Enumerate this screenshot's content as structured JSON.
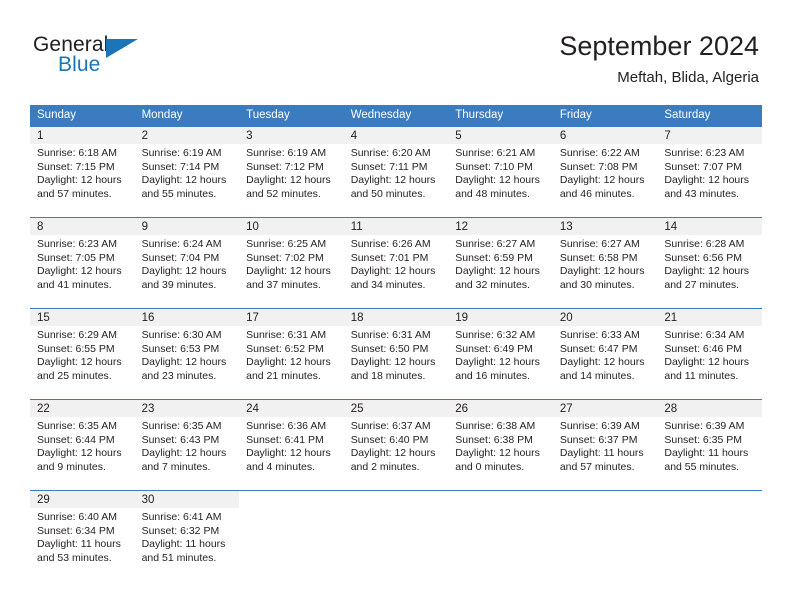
{
  "brand": {
    "name_part1": "General",
    "name_part2": "Blue",
    "accent_color": "#1b75bb",
    "flag_icon": "brand-flag-icon"
  },
  "header": {
    "title": "September 2024",
    "location": "Meftah, Blida, Algeria"
  },
  "calendar": {
    "header_bg": "#3b7cc0",
    "daynum_bg": "#f1f1f1",
    "weekdays": [
      "Sunday",
      "Monday",
      "Tuesday",
      "Wednesday",
      "Thursday",
      "Friday",
      "Saturday"
    ],
    "weeks": [
      [
        {
          "day": "1",
          "sunrise": "Sunrise: 6:18 AM",
          "sunset": "Sunset: 7:15 PM",
          "daylight": "Daylight: 12 hours and 57 minutes."
        },
        {
          "day": "2",
          "sunrise": "Sunrise: 6:19 AM",
          "sunset": "Sunset: 7:14 PM",
          "daylight": "Daylight: 12 hours and 55 minutes."
        },
        {
          "day": "3",
          "sunrise": "Sunrise: 6:19 AM",
          "sunset": "Sunset: 7:12 PM",
          "daylight": "Daylight: 12 hours and 52 minutes."
        },
        {
          "day": "4",
          "sunrise": "Sunrise: 6:20 AM",
          "sunset": "Sunset: 7:11 PM",
          "daylight": "Daylight: 12 hours and 50 minutes."
        },
        {
          "day": "5",
          "sunrise": "Sunrise: 6:21 AM",
          "sunset": "Sunset: 7:10 PM",
          "daylight": "Daylight: 12 hours and 48 minutes."
        },
        {
          "day": "6",
          "sunrise": "Sunrise: 6:22 AM",
          "sunset": "Sunset: 7:08 PM",
          "daylight": "Daylight: 12 hours and 46 minutes."
        },
        {
          "day": "7",
          "sunrise": "Sunrise: 6:23 AM",
          "sunset": "Sunset: 7:07 PM",
          "daylight": "Daylight: 12 hours and 43 minutes."
        }
      ],
      [
        {
          "day": "8",
          "sunrise": "Sunrise: 6:23 AM",
          "sunset": "Sunset: 7:05 PM",
          "daylight": "Daylight: 12 hours and 41 minutes."
        },
        {
          "day": "9",
          "sunrise": "Sunrise: 6:24 AM",
          "sunset": "Sunset: 7:04 PM",
          "daylight": "Daylight: 12 hours and 39 minutes."
        },
        {
          "day": "10",
          "sunrise": "Sunrise: 6:25 AM",
          "sunset": "Sunset: 7:02 PM",
          "daylight": "Daylight: 12 hours and 37 minutes."
        },
        {
          "day": "11",
          "sunrise": "Sunrise: 6:26 AM",
          "sunset": "Sunset: 7:01 PM",
          "daylight": "Daylight: 12 hours and 34 minutes."
        },
        {
          "day": "12",
          "sunrise": "Sunrise: 6:27 AM",
          "sunset": "Sunset: 6:59 PM",
          "daylight": "Daylight: 12 hours and 32 minutes."
        },
        {
          "day": "13",
          "sunrise": "Sunrise: 6:27 AM",
          "sunset": "Sunset: 6:58 PM",
          "daylight": "Daylight: 12 hours and 30 minutes."
        },
        {
          "day": "14",
          "sunrise": "Sunrise: 6:28 AM",
          "sunset": "Sunset: 6:56 PM",
          "daylight": "Daylight: 12 hours and 27 minutes."
        }
      ],
      [
        {
          "day": "15",
          "sunrise": "Sunrise: 6:29 AM",
          "sunset": "Sunset: 6:55 PM",
          "daylight": "Daylight: 12 hours and 25 minutes."
        },
        {
          "day": "16",
          "sunrise": "Sunrise: 6:30 AM",
          "sunset": "Sunset: 6:53 PM",
          "daylight": "Daylight: 12 hours and 23 minutes."
        },
        {
          "day": "17",
          "sunrise": "Sunrise: 6:31 AM",
          "sunset": "Sunset: 6:52 PM",
          "daylight": "Daylight: 12 hours and 21 minutes."
        },
        {
          "day": "18",
          "sunrise": "Sunrise: 6:31 AM",
          "sunset": "Sunset: 6:50 PM",
          "daylight": "Daylight: 12 hours and 18 minutes."
        },
        {
          "day": "19",
          "sunrise": "Sunrise: 6:32 AM",
          "sunset": "Sunset: 6:49 PM",
          "daylight": "Daylight: 12 hours and 16 minutes."
        },
        {
          "day": "20",
          "sunrise": "Sunrise: 6:33 AM",
          "sunset": "Sunset: 6:47 PM",
          "daylight": "Daylight: 12 hours and 14 minutes."
        },
        {
          "day": "21",
          "sunrise": "Sunrise: 6:34 AM",
          "sunset": "Sunset: 6:46 PM",
          "daylight": "Daylight: 12 hours and 11 minutes."
        }
      ],
      [
        {
          "day": "22",
          "sunrise": "Sunrise: 6:35 AM",
          "sunset": "Sunset: 6:44 PM",
          "daylight": "Daylight: 12 hours and 9 minutes."
        },
        {
          "day": "23",
          "sunrise": "Sunrise: 6:35 AM",
          "sunset": "Sunset: 6:43 PM",
          "daylight": "Daylight: 12 hours and 7 minutes."
        },
        {
          "day": "24",
          "sunrise": "Sunrise: 6:36 AM",
          "sunset": "Sunset: 6:41 PM",
          "daylight": "Daylight: 12 hours and 4 minutes."
        },
        {
          "day": "25",
          "sunrise": "Sunrise: 6:37 AM",
          "sunset": "Sunset: 6:40 PM",
          "daylight": "Daylight: 12 hours and 2 minutes."
        },
        {
          "day": "26",
          "sunrise": "Sunrise: 6:38 AM",
          "sunset": "Sunset: 6:38 PM",
          "daylight": "Daylight: 12 hours and 0 minutes."
        },
        {
          "day": "27",
          "sunrise": "Sunrise: 6:39 AM",
          "sunset": "Sunset: 6:37 PM",
          "daylight": "Daylight: 11 hours and 57 minutes."
        },
        {
          "day": "28",
          "sunrise": "Sunrise: 6:39 AM",
          "sunset": "Sunset: 6:35 PM",
          "daylight": "Daylight: 11 hours and 55 minutes."
        }
      ],
      [
        {
          "day": "29",
          "sunrise": "Sunrise: 6:40 AM",
          "sunset": "Sunset: 6:34 PM",
          "daylight": "Daylight: 11 hours and 53 minutes."
        },
        {
          "day": "30",
          "sunrise": "Sunrise: 6:41 AM",
          "sunset": "Sunset: 6:32 PM",
          "daylight": "Daylight: 11 hours and 51 minutes."
        },
        {
          "day": "",
          "sunrise": "",
          "sunset": "",
          "daylight": ""
        },
        {
          "day": "",
          "sunrise": "",
          "sunset": "",
          "daylight": ""
        },
        {
          "day": "",
          "sunrise": "",
          "sunset": "",
          "daylight": ""
        },
        {
          "day": "",
          "sunrise": "",
          "sunset": "",
          "daylight": ""
        },
        {
          "day": "",
          "sunrise": "",
          "sunset": "",
          "daylight": ""
        }
      ]
    ]
  }
}
